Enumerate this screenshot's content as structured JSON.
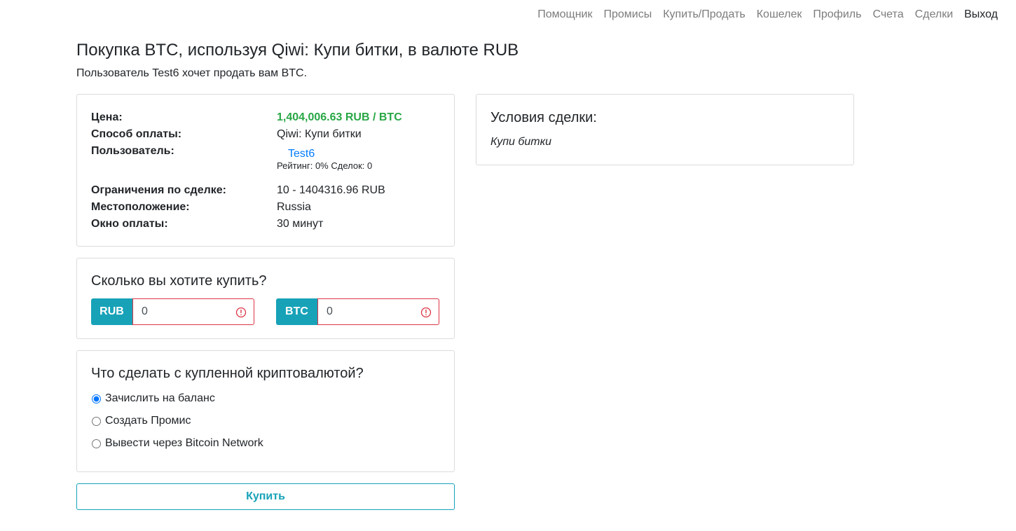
{
  "nav": {
    "items": [
      "Помощник",
      "Промисы",
      "Купить/Продать",
      "Кошелек",
      "Профиль",
      "Счета",
      "Сделки",
      "Выход"
    ]
  },
  "page": {
    "title": "Покупка BTC, используя Qiwi: Купи битки, в валюте RUB",
    "subtitle": "Пользователь Test6 хочет продать вам BTC."
  },
  "info": {
    "price_label": "Цена:",
    "price_value": "1,404,006.63 RUB / BTC",
    "method_label": "Способ оплаты:",
    "method_value": "Qiwi: Купи битки",
    "user_label": "Пользователь:",
    "user_name": "Test6",
    "user_meta": "Рейтинг: 0% Сделок: 0",
    "limits_label": "Ограничения по сделке:",
    "limits_value": "10 - 1404316.96 RUB",
    "location_label": "Местоположение:",
    "location_value": "Russia",
    "window_label": "Окно оплаты:",
    "window_value": "30 минут"
  },
  "terms": {
    "title": "Условия сделки:",
    "text": "Купи битки"
  },
  "amount": {
    "title": "Сколько вы хотите купить?",
    "fiat_label": "RUB",
    "fiat_value": "0",
    "crypto_label": "BTC",
    "crypto_value": "0"
  },
  "action": {
    "title": "Что сделать с купленной криптовалютой?",
    "options": [
      "Зачислить на баланс",
      "Создать Промис",
      "Вывести через Bitcoin Network"
    ],
    "selected_index": 0
  },
  "buy_label": "Купить",
  "colors": {
    "accent": "#17a2b8",
    "price": "#28a745",
    "link": "#007bff",
    "error": "#dc3545"
  }
}
